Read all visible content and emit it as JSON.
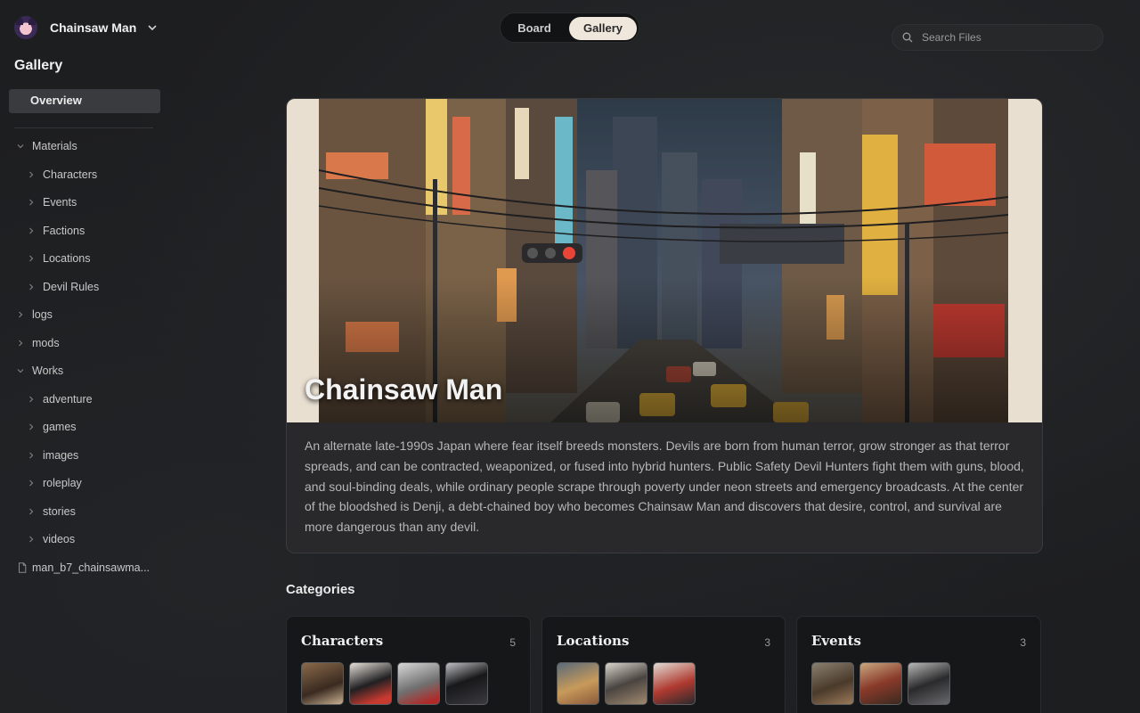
{
  "workspace": {
    "name": "Chainsaw Man"
  },
  "sidebar": {
    "section_title": "Gallery",
    "overview_label": "Overview",
    "tree": [
      {
        "label": "Materials",
        "expanded": true,
        "depth": 0
      },
      {
        "label": "Characters",
        "expanded": false,
        "depth": 1
      },
      {
        "label": "Events",
        "expanded": false,
        "depth": 1
      },
      {
        "label": "Factions",
        "expanded": false,
        "depth": 1
      },
      {
        "label": "Locations",
        "expanded": false,
        "depth": 1
      },
      {
        "label": "Devil Rules",
        "expanded": false,
        "depth": 1
      },
      {
        "label": "logs",
        "expanded": false,
        "depth": 0
      },
      {
        "label": "mods",
        "expanded": false,
        "depth": 0
      },
      {
        "label": "Works",
        "expanded": true,
        "depth": 0
      },
      {
        "label": "adventure",
        "expanded": false,
        "depth": 1
      },
      {
        "label": "games",
        "expanded": false,
        "depth": 1
      },
      {
        "label": "images",
        "expanded": false,
        "depth": 1
      },
      {
        "label": "roleplay",
        "expanded": false,
        "depth": 1
      },
      {
        "label": "stories",
        "expanded": false,
        "depth": 1
      },
      {
        "label": "videos",
        "expanded": false,
        "depth": 1
      }
    ],
    "file_label": "man_b7_chainsawma..."
  },
  "view_toggle": {
    "board_label": "Board",
    "gallery_label": "Gallery",
    "active": "Gallery"
  },
  "search": {
    "placeholder": "Search Files",
    "value": ""
  },
  "hero": {
    "title": "Chainsaw Man",
    "description": "An alternate late-1990s Japan where fear itself breeds monsters. Devils are born from human terror, grow stronger as that terror spreads, and can be contracted, weaponized, or fused into hybrid hunters. Public Safety Devil Hunters fight them with guns, blood, and soul-binding deals, while ordinary people scrape through poverty under neon streets and emergency broadcasts. At the center of the bloodshed is Denji, a debt-chained boy who becomes Chainsaw Man and discovers that desire, control, and survival are more dangerous than any devil."
  },
  "categories": {
    "heading": "Categories",
    "items": [
      {
        "title": "Characters",
        "count": "5"
      },
      {
        "title": "Locations",
        "count": "3"
      },
      {
        "title": "Events",
        "count": "3"
      }
    ]
  },
  "colors": {
    "background": "#1d1e20",
    "toggle_active": "#efe6dc",
    "overview_bg": "#3a3b3e"
  },
  "icons": {
    "workspace_logo": "anime-avatar-icon",
    "workspace_menu": "chevron-down-icon",
    "search": "search-icon",
    "tree_expanded": "chevron-down-icon",
    "tree_collapsed": "chevron-right-icon",
    "file": "file-icon"
  }
}
